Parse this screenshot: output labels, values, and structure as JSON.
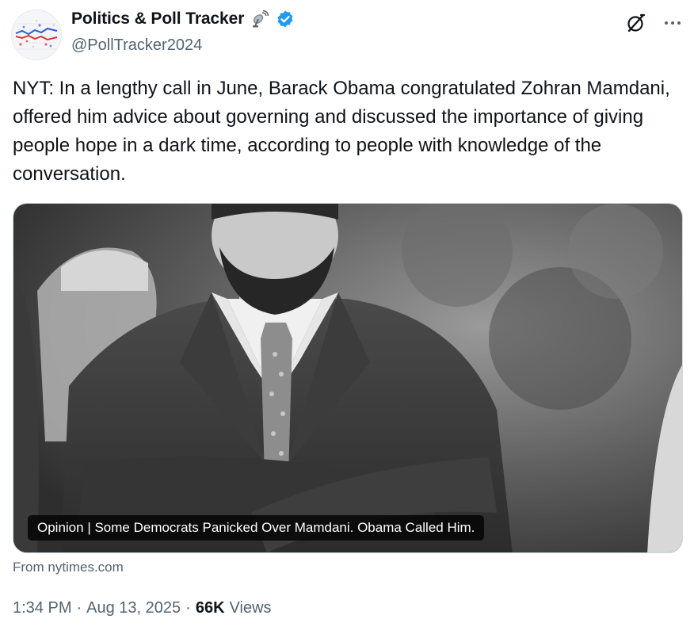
{
  "author": {
    "display_name": "Politics & Poll Tracker",
    "handle": "@PollTracker2024",
    "verified": true,
    "name_emoji": "satellite-antenna-icon"
  },
  "tweet": {
    "text": "NYT: In a lengthy call in June, Barack Obama congratulated Zohran Mamdani, offered him advice about governing and discussed the importance of giving people hope in a dark time, according to people with knowledge of the conversation."
  },
  "card": {
    "caption": "Opinion | Some Democrats Panicked Over Mamdani. Obama Called Him.",
    "source": "From nytimes.com"
  },
  "meta": {
    "time": "1:34 PM",
    "separator": "·",
    "date": "Aug 13, 2025",
    "views_count": "66K",
    "views_label": "Views"
  },
  "colors": {
    "text_primary": "#0f1419",
    "text_secondary": "#536471",
    "verified_blue": "#1d9bf0",
    "border": "#cfd9de"
  },
  "icons": {
    "grok": "grok-icon",
    "more": "more-icon",
    "verified": "verified-badge-icon"
  }
}
